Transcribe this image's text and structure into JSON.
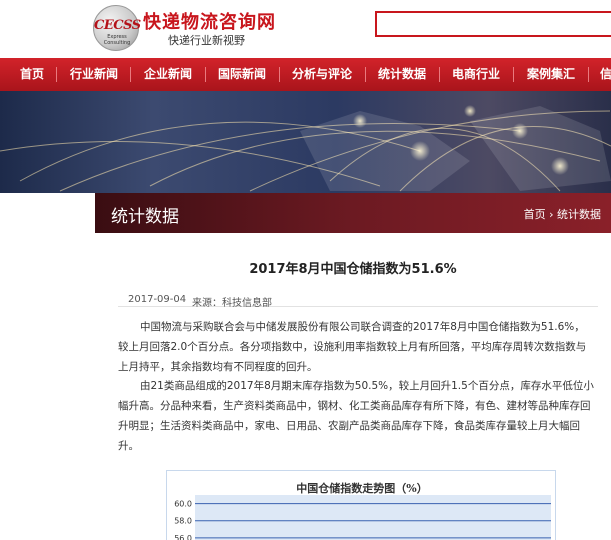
{
  "header": {
    "logo_text": "CECSS",
    "logo_subtext": "Express Consulting",
    "site_title": "快递物流咨询网",
    "slogan": "快递行业新视野"
  },
  "nav": {
    "items": [
      {
        "label": "首页"
      },
      {
        "label": "行业新闻"
      },
      {
        "label": "企业新闻"
      },
      {
        "label": "国际新闻"
      },
      {
        "label": "分析与评论"
      },
      {
        "label": "统计数据"
      },
      {
        "label": "电商行业"
      },
      {
        "label": "案例集汇"
      },
      {
        "label": "信"
      }
    ]
  },
  "section": {
    "title": "统计数据",
    "breadcrumb_home": "首页",
    "breadcrumb_separator": "›",
    "breadcrumb_current": "统计数据"
  },
  "article": {
    "title": "2017年8月中国仓储指数为51.6%",
    "date": "2017-09-04",
    "source": "来源：科技信息部",
    "paragraphs": [
      "中国物流与采购联合会与中储发展股份有限公司联合调查的2017年8月中国仓储指数为51.6%，较上月回落2.0个百分点。各分项指数中，设施利用率指数较上月有所回落，平均库存周转次数指数与上月持平，其余指数均有不同程度的回升。",
      "由21类商品组成的2017年8月期末库存指数为50.5%，较上月回升1.5个百分点，库存水平低位小幅升高。分品种来看，生产资料类商品中，钢材、化工类商品库存有所下降，有色、建材等品种库存回升明显；生活资料类商品中，家电、日用品、农副产品类商品库存下降，食品类库存量较上月大幅回升。"
    ]
  },
  "chart_data": {
    "type": "line",
    "title": "中国仓储指数走势图（%）",
    "y_ticks": [
      "60.0",
      "58.0",
      "56.0"
    ],
    "ylim": [
      54,
      61
    ],
    "grid": true,
    "series_color": "#1f4e9c"
  }
}
